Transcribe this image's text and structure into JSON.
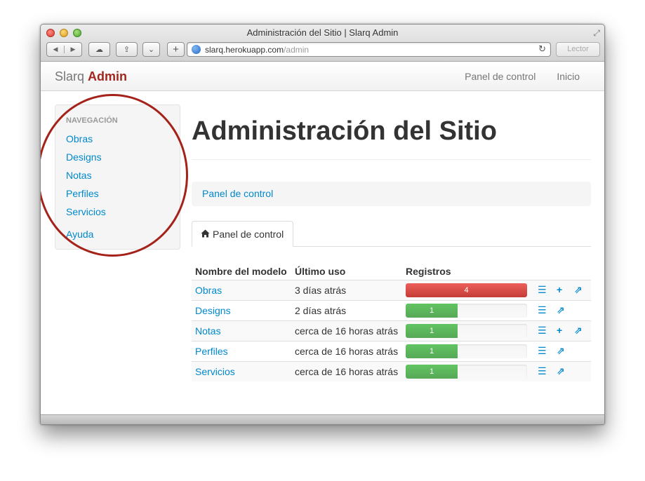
{
  "window": {
    "title": "Administración del Sitio | Slarq Admin"
  },
  "toolbar": {
    "url_host": "slarq.herokuapp.com",
    "url_path": "/admin",
    "reader_label": "Lector"
  },
  "navbar": {
    "brand_prefix": "Slarq",
    "brand_accent": "Admin",
    "items": [
      "Panel de control",
      "Inicio"
    ]
  },
  "sidebar": {
    "header": "NAVEGACIÓN",
    "items": [
      "Obras",
      "Designs",
      "Notas",
      "Perfiles",
      "Servicios"
    ],
    "help": "Ayuda"
  },
  "main": {
    "title": "Administración del Sitio",
    "breadcrumb": "Panel de control",
    "tab_label": "Panel de control"
  },
  "table": {
    "headers": [
      "Nombre del modelo",
      "Último uso",
      "Registros"
    ],
    "rows": [
      {
        "name": "Obras",
        "last_used": "3 días atrás",
        "count": "4",
        "fill": 1.0,
        "bar_color": "#c43c35",
        "actions": [
          "list",
          "add",
          "export"
        ]
      },
      {
        "name": "Designs",
        "last_used": "2 días atrás",
        "count": "1",
        "fill": 0.43,
        "bar_color": "#57a957",
        "actions": [
          "list",
          "export"
        ]
      },
      {
        "name": "Notas",
        "last_used": "cerca de 16 horas atrás",
        "count": "1",
        "fill": 0.43,
        "bar_color": "#57a957",
        "actions": [
          "list",
          "add",
          "export"
        ]
      },
      {
        "name": "Perfiles",
        "last_used": "cerca de 16 horas atrás",
        "count": "1",
        "fill": 0.43,
        "bar_color": "#57a957",
        "actions": [
          "list",
          "export"
        ]
      },
      {
        "name": "Servicios",
        "last_used": "cerca de 16 horas atrás",
        "count": "1",
        "fill": 0.43,
        "bar_color": "#57a957",
        "actions": [
          "list",
          "export"
        ]
      }
    ]
  },
  "colors": {
    "link": "#0088cc",
    "brand_accent": "#a1261d",
    "annotation_circle": "#a42219"
  }
}
